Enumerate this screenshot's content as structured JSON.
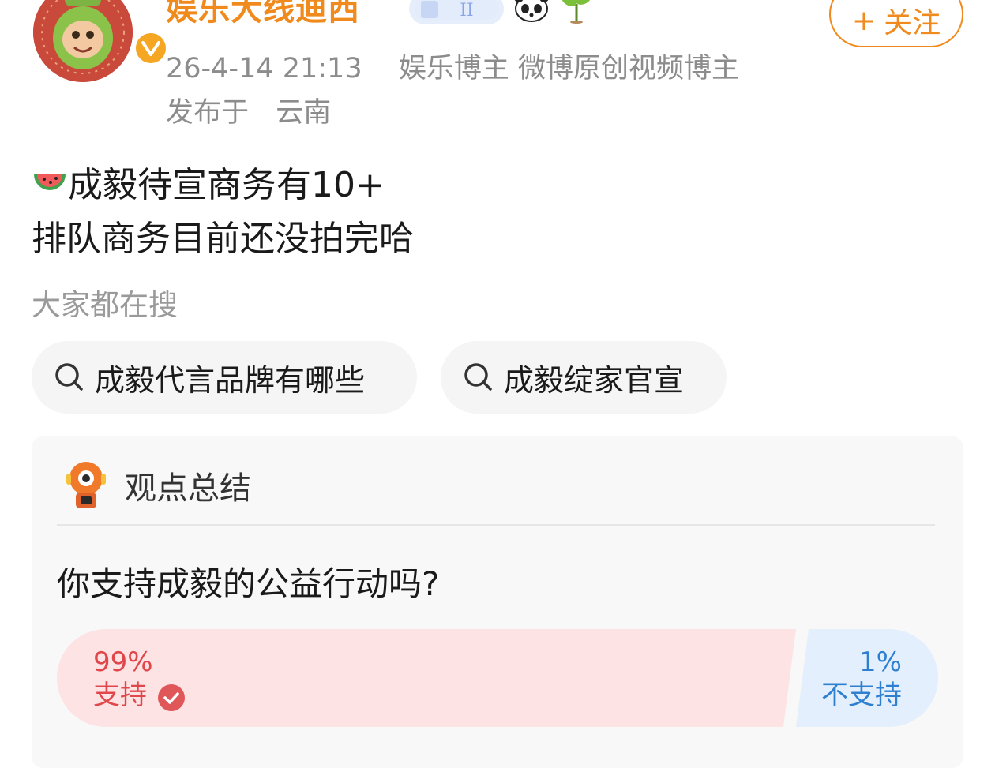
{
  "user": {
    "name": "娱乐大线迪西",
    "follow_label": "关注",
    "follow_plus": "+"
  },
  "meta": {
    "time": "26-4-14 21:13",
    "tags": "娱乐博主 微博原创视频博主",
    "location_prefix": "发布于",
    "location": "云南"
  },
  "post": {
    "line1": "成毅待宣商务有10+",
    "line2": "排队商务目前还没拍完哈"
  },
  "search": {
    "title": "大家都在搜",
    "chips": [
      "成毅代言品牌有哪些",
      "成毅绽家官宣"
    ]
  },
  "summary": {
    "title": "观点总结",
    "question": "你支持成毅的公益行动吗?",
    "yes": {
      "percent_text": "99%",
      "label": "支持",
      "share": 0.99
    },
    "no": {
      "percent_text": "1%",
      "label": "不支持",
      "share": 0.01
    }
  },
  "colors": {
    "accent_orange": "#f08a1c",
    "yes_red": "#e0474a",
    "yes_fill": "#fde3e4",
    "no_blue": "#2f7fd1",
    "no_fill": "#e3effc"
  }
}
